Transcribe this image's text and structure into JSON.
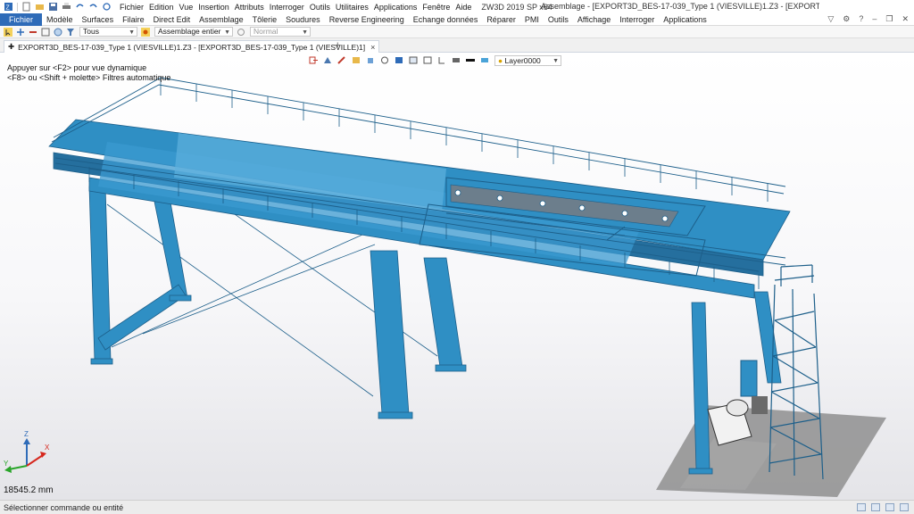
{
  "app": {
    "name": "ZW3D 2019 SP x64",
    "window_title": "Assemblage - [EXPORT3D_BES-17-039_Type 1 (VIESVILLE)1.Z3 - [EXPORT3D_BES-17-039_Type 1 (VIES..."
  },
  "top_menu": [
    "Fichier",
    "Edition",
    "Vue",
    "Insertion",
    "Attributs",
    "Interroger",
    "Outils",
    "Utilitaires",
    "Applications",
    "Fenêtre",
    "Aide"
  ],
  "ribbon": {
    "file_label": "Fichier",
    "tabs": [
      "Modèle",
      "Surfaces",
      "Filaire",
      "Direct Edit",
      "Assemblage",
      "Tôlerie",
      "Soudures",
      "Reverse Engineering",
      "Echange données",
      "Réparer",
      "PMI",
      "Outils",
      "Affichage",
      "Interroger",
      "Applications"
    ]
  },
  "toolbar": {
    "filter_value": "Tous",
    "assembly_value": "Assemblage entier",
    "mode_value": "Normal"
  },
  "document": {
    "tab_label": "EXPORT3D_BES-17-039_Type 1 (VIESVILLE)1.Z3 - [EXPORT3D_BES-17-039_Type 1 (VIESVILLE)1]",
    "close_glyph": "×",
    "new_tab_glyph": "+"
  },
  "viewport": {
    "hint_line1": "Appuyer sur <F2> pour vue dynamique",
    "hint_line2": "<F8> ou <Shift + molette> Filtres automatique",
    "layer": "Layer0000",
    "scale_readout": "18545.2 mm",
    "axes": {
      "x": "X",
      "y": "Y",
      "z": "Z"
    }
  },
  "status": {
    "text": "Sélectionner commande ou entité"
  },
  "colors": {
    "accent": "#2e6bb8",
    "steel": "#2f8fc4",
    "steel_dark": "#1d5f8a",
    "ground": "#8f8f8f"
  }
}
